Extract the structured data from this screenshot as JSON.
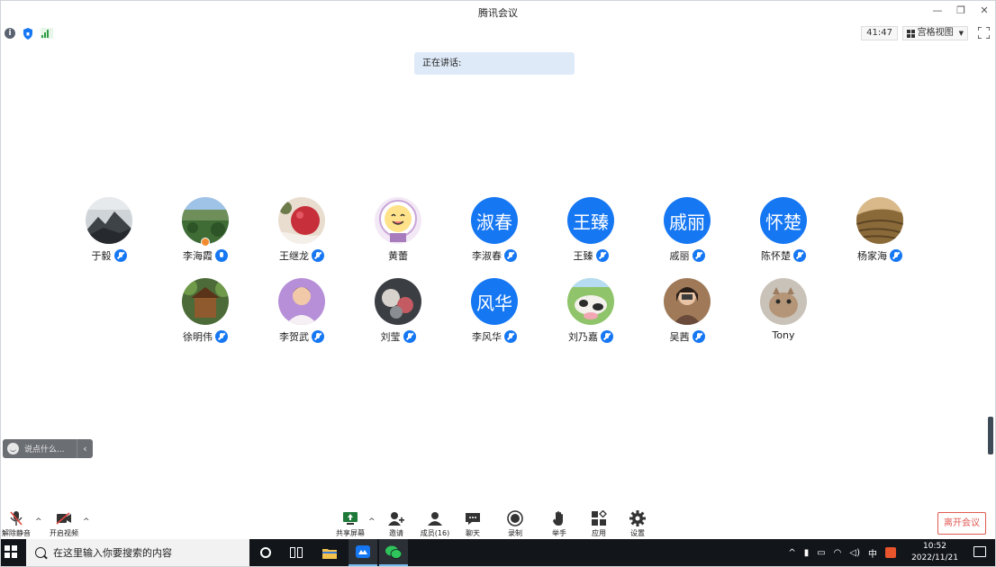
{
  "window": {
    "title": "腾讯会议"
  },
  "infobar": {
    "timer": "41:47",
    "view_label": "宫格视图"
  },
  "speaking": {
    "label": "正在讲话:"
  },
  "participants": [
    {
      "name": "于毅",
      "mic": "muted"
    },
    {
      "name": "李海霞",
      "mic": "on"
    },
    {
      "name": "王继龙",
      "mic": "muted"
    },
    {
      "name": "黄蕾",
      "mic": "none"
    },
    {
      "name": "李淑春",
      "mic": "muted",
      "initials": "淑春"
    },
    {
      "name": "王臻",
      "mic": "muted",
      "initials": "王臻"
    },
    {
      "name": "戚丽",
      "mic": "muted",
      "initials": "戚丽"
    },
    {
      "name": "陈怀楚",
      "mic": "muted",
      "initials": "怀楚"
    },
    {
      "name": "杨家海",
      "mic": "muted"
    },
    {
      "name": "徐明伟",
      "mic": "muted"
    },
    {
      "name": "李贺武",
      "mic": "muted"
    },
    {
      "name": "刘莹",
      "mic": "muted"
    },
    {
      "name": "李风华",
      "mic": "muted",
      "initials": "风华"
    },
    {
      "name": "刘乃嘉",
      "mic": "muted"
    },
    {
      "name": "吴茜",
      "mic": "muted"
    },
    {
      "name": "Tony",
      "mic": "none"
    }
  ],
  "chat": {
    "placeholder": "说点什么..."
  },
  "toolbar": {
    "unmute": "解除静音",
    "video": "开启视频",
    "share": "共享屏幕",
    "invite": "邀请",
    "members": "成员(16)",
    "chat": "聊天",
    "record": "录制",
    "raise_hand": "举手",
    "apps": "应用",
    "settings": "设置",
    "leave": "离开会议"
  },
  "taskbar": {
    "search_placeholder": "在这里输入你要搜索的内容",
    "ime": "中",
    "time": "10:52",
    "date": "2022/11/21"
  },
  "colors": {
    "accent": "#1677f3",
    "leave": "#e05a52",
    "taskbar": "#12151a"
  }
}
